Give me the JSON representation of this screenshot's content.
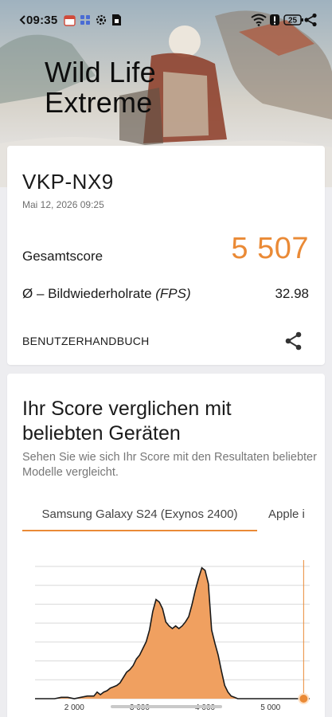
{
  "status_bar": {
    "time": "09:35",
    "icons": [
      "calendar-icon",
      "apps-grid-icon",
      "settings-gear-icon",
      "sim-card-icon"
    ],
    "right_icons": [
      "wifi-icon",
      "alert-icon",
      "battery-icon",
      "share-icon"
    ],
    "battery_level": "25"
  },
  "hero": {
    "title_line1": "Wild Life",
    "title_line2": "Extreme"
  },
  "result_card": {
    "device": "VKP-NX9",
    "date": "Mai 12, 2026 09:25",
    "score_label": "Gesamtscore",
    "score_value": "5 507",
    "fps_label_prefix": "Ø – Bildwiederholrate ",
    "fps_label_unit": "(FPS)",
    "fps_value": "32.98",
    "manual_button": "BENUTZERHANDBUCH",
    "share_icon": "share-icon"
  },
  "comparison_card": {
    "title": "Ihr Score verglichen mit beliebten Geräten",
    "subtitle": "Sehen Sie wie sich Ihr Score mit den Resultaten beliebter Modelle vergleicht.",
    "tabs": [
      {
        "label": "Samsung Galaxy S24 (Exynos 2400)",
        "active": true
      },
      {
        "label": "Apple i",
        "active": false
      }
    ]
  },
  "colors": {
    "accent": "#ea8a36",
    "histogram_fill": "#f0a060",
    "histogram_stroke": "#1a1a1a"
  },
  "chart_data": {
    "type": "area",
    "x_ticks": [
      "2 000",
      "3 000",
      "4 000",
      "5 000"
    ],
    "xlim": [
      1400,
      5600
    ],
    "marker_score": 5507,
    "points": [
      [
        1400,
        0
      ],
      [
        1700,
        0
      ],
      [
        1800,
        0.01
      ],
      [
        1900,
        0.01
      ],
      [
        2000,
        0
      ],
      [
        2100,
        0.01
      ],
      [
        2200,
        0.02
      ],
      [
        2300,
        0.02
      ],
      [
        2350,
        0.05
      ],
      [
        2400,
        0.03
      ],
      [
        2450,
        0.05
      ],
      [
        2500,
        0.06
      ],
      [
        2550,
        0.08
      ],
      [
        2600,
        0.09
      ],
      [
        2650,
        0.1
      ],
      [
        2700,
        0.12
      ],
      [
        2750,
        0.16
      ],
      [
        2800,
        0.2
      ],
      [
        2850,
        0.22
      ],
      [
        2900,
        0.25
      ],
      [
        2950,
        0.3
      ],
      [
        3000,
        0.33
      ],
      [
        3050,
        0.38
      ],
      [
        3100,
        0.43
      ],
      [
        3150,
        0.52
      ],
      [
        3200,
        0.66
      ],
      [
        3250,
        0.75
      ],
      [
        3300,
        0.73
      ],
      [
        3350,
        0.68
      ],
      [
        3400,
        0.58
      ],
      [
        3450,
        0.55
      ],
      [
        3500,
        0.53
      ],
      [
        3550,
        0.55
      ],
      [
        3600,
        0.53
      ],
      [
        3650,
        0.55
      ],
      [
        3700,
        0.58
      ],
      [
        3750,
        0.62
      ],
      [
        3800,
        0.71
      ],
      [
        3850,
        0.82
      ],
      [
        3900,
        0.91
      ],
      [
        3950,
        0.99
      ],
      [
        4000,
        0.97
      ],
      [
        4050,
        0.87
      ],
      [
        4100,
        0.52
      ],
      [
        4150,
        0.42
      ],
      [
        4200,
        0.33
      ],
      [
        4250,
        0.21
      ],
      [
        4300,
        0.1
      ],
      [
        4350,
        0.05
      ],
      [
        4400,
        0.02
      ],
      [
        4450,
        0.01
      ],
      [
        4500,
        0
      ],
      [
        5600,
        0
      ]
    ]
  }
}
